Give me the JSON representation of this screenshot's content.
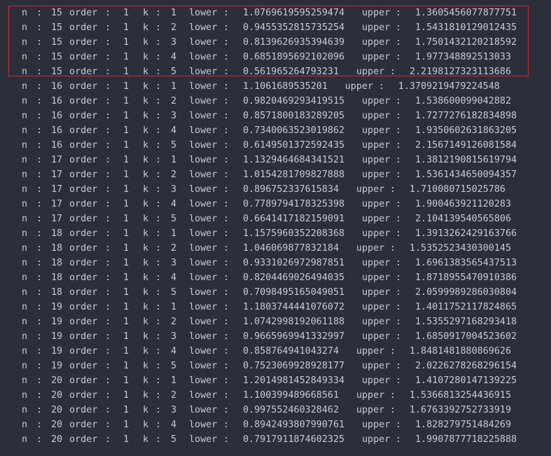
{
  "highlight": {
    "color": "#d7262a"
  },
  "labels": {
    "n": "n",
    "order": "order",
    "k": "k",
    "lower": "lower",
    "upper": "upper",
    "colon": ":"
  },
  "rows": [
    {
      "n": "15",
      "order": "1",
      "k": "1",
      "lower": "1.0769619595259474",
      "upper": "1.3605456077877751"
    },
    {
      "n": "15",
      "order": "1",
      "k": "2",
      "lower": "0.9455352815735254",
      "upper": "1.5431810129012435"
    },
    {
      "n": "15",
      "order": "1",
      "k": "3",
      "lower": "0.8139626935394639",
      "upper": "1.7501432120218592"
    },
    {
      "n": "15",
      "order": "1",
      "k": "4",
      "lower": "0.6851895692102096",
      "upper": "1.977348892513033"
    },
    {
      "n": "15",
      "order": "1",
      "k": "5",
      "lower": "0.561965264793231",
      "upper": "2.2198127323113686"
    },
    {
      "n": "16",
      "order": "1",
      "k": "1",
      "lower": "1.1061689535201",
      "upper": "1.3709219479224548"
    },
    {
      "n": "16",
      "order": "1",
      "k": "2",
      "lower": "0.9820469293419515",
      "upper": "1.538600099042882"
    },
    {
      "n": "16",
      "order": "1",
      "k": "3",
      "lower": "0.8571800183289205",
      "upper": "1.7277276182834898"
    },
    {
      "n": "16",
      "order": "1",
      "k": "4",
      "lower": "0.7340063523019862",
      "upper": "1.9350602631863205"
    },
    {
      "n": "16",
      "order": "1",
      "k": "5",
      "lower": "0.6149501372592435",
      "upper": "2.1567149126081584"
    },
    {
      "n": "17",
      "order": "1",
      "k": "1",
      "lower": "1.1329464684341521",
      "upper": "1.3812190815619794"
    },
    {
      "n": "17",
      "order": "1",
      "k": "2",
      "lower": "1.0154281709827888",
      "upper": "1.5361434650094357"
    },
    {
      "n": "17",
      "order": "1",
      "k": "3",
      "lower": "0.896752337615834",
      "upper": "1.710080715025786"
    },
    {
      "n": "17",
      "order": "1",
      "k": "4",
      "lower": "0.7789794178325398",
      "upper": "1.900463921120283"
    },
    {
      "n": "17",
      "order": "1",
      "k": "5",
      "lower": "0.6641417182159091",
      "upper": "2.104139540565806"
    },
    {
      "n": "18",
      "order": "1",
      "k": "1",
      "lower": "1.1575960352208368",
      "upper": "1.3913262429163766"
    },
    {
      "n": "18",
      "order": "1",
      "k": "2",
      "lower": "1.046069877832184",
      "upper": "1.5352523430300145"
    },
    {
      "n": "18",
      "order": "1",
      "k": "3",
      "lower": "0.9331026972987851",
      "upper": "1.6961383565437513"
    },
    {
      "n": "18",
      "order": "1",
      "k": "4",
      "lower": "0.8204469026494035",
      "upper": "1.8718955470910386"
    },
    {
      "n": "18",
      "order": "1",
      "k": "5",
      "lower": "0.7098495165049051",
      "upper": "2.0599989286030804"
    },
    {
      "n": "19",
      "order": "1",
      "k": "1",
      "lower": "1.1803744441076072",
      "upper": "1.4011752117824865"
    },
    {
      "n": "19",
      "order": "1",
      "k": "2",
      "lower": "1.0742998192061188",
      "upper": "1.5355297168293418"
    },
    {
      "n": "19",
      "order": "1",
      "k": "3",
      "lower": "0.9665969941332997",
      "upper": "1.6850917004523602"
    },
    {
      "n": "19",
      "order": "1",
      "k": "4",
      "lower": "0.858764941043274",
      "upper": "1.8481481880869626"
    },
    {
      "n": "19",
      "order": "1",
      "k": "5",
      "lower": "0.7523069928928177",
      "upper": "2.0226278268296154"
    },
    {
      "n": "20",
      "order": "1",
      "k": "1",
      "lower": "1.2014981452849334",
      "upper": "1.4107280147139225"
    },
    {
      "n": "20",
      "order": "1",
      "k": "2",
      "lower": "1.100399489668561",
      "upper": "1.5366813254436915"
    },
    {
      "n": "20",
      "order": "1",
      "k": "3",
      "lower": "0.997552460328462",
      "upper": "1.6763392752733919"
    },
    {
      "n": "20",
      "order": "1",
      "k": "4",
      "lower": "0.8942493807990761",
      "upper": "1.828279751484269"
    },
    {
      "n": "20",
      "order": "1",
      "k": "5",
      "lower": "0.7917911874602325",
      "upper": "1.9907877718225888"
    }
  ]
}
